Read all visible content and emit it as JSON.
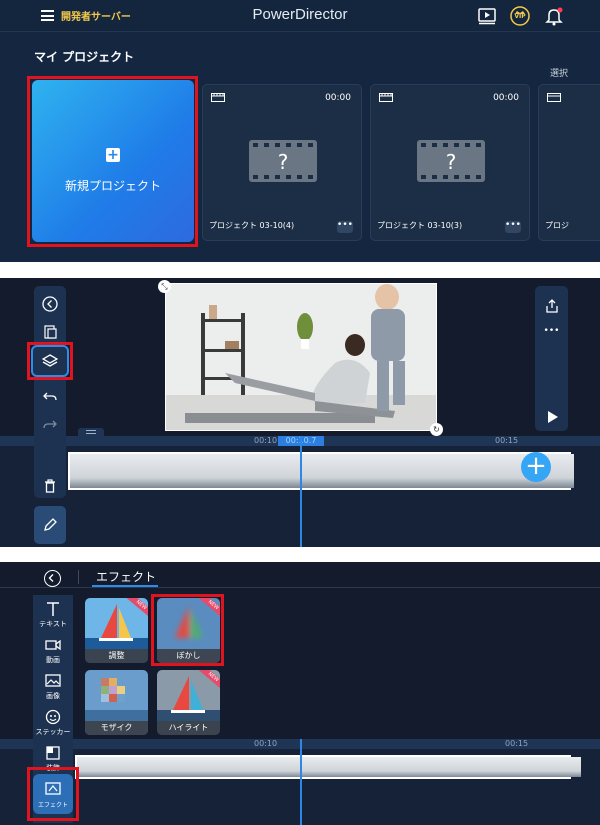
{
  "panel1": {
    "dev_server": "開発者サーバー",
    "app_title": "PowerDirector",
    "vip_label": "VIP",
    "section_title": "マイ プロジェクト",
    "select_label": "選択",
    "new_project_label": "新規プロジェクト",
    "projects": [
      {
        "name": "プロジェクト 03-10(4)",
        "duration": "00:00"
      },
      {
        "name": "プロジェクト 03-10(3)",
        "duration": "00:00"
      },
      {
        "name": "プロジ"
      }
    ],
    "more_label": "•••"
  },
  "panel2": {
    "ruler": {
      "left": "00:10",
      "current": "00:10.7",
      "right": "00:15"
    },
    "more_label": "•••"
  },
  "panel3": {
    "tab_label": "エフェクト",
    "side_menu": [
      {
        "label": "テキスト",
        "icon": "text-icon"
      },
      {
        "label": "動画",
        "icon": "video-icon"
      },
      {
        "label": "画像",
        "icon": "image-icon"
      },
      {
        "label": "ステッカー",
        "icon": "sticker-icon"
      },
      {
        "label": "装飾",
        "icon": "decoration-icon"
      },
      {
        "label": "エフェクト",
        "icon": "effect-icon"
      }
    ],
    "effects": [
      {
        "label": "調整",
        "new": true
      },
      {
        "label": "ぼかし",
        "new": true
      },
      {
        "label": "モザイク",
        "new": false
      },
      {
        "label": "ハイライト",
        "new": true
      }
    ],
    "new_badge": "NEW",
    "ruler": {
      "left": "00:10",
      "right": "00:15"
    }
  },
  "colors": {
    "highlight": "#e0141e",
    "accent": "#2f8de8",
    "dev_text": "#f2c94c"
  }
}
